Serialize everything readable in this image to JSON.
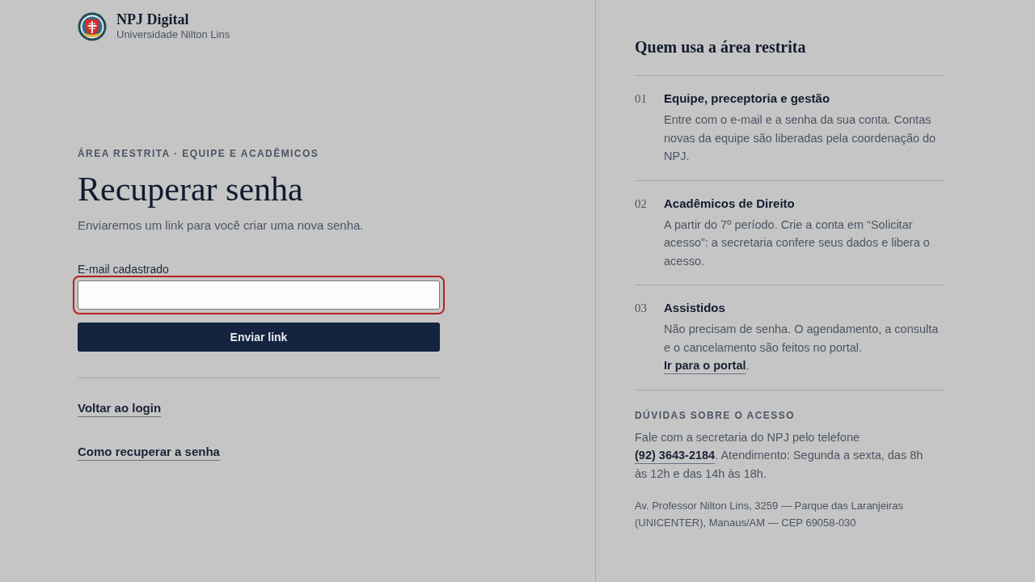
{
  "brand": {
    "name": "NPJ Digital",
    "subtitle": "Universidade Nilton Lins"
  },
  "form": {
    "eyebrow": "ÁREA RESTRITA · EQUIPE E ACADÊMICOS",
    "title": "Recuperar senha",
    "subtitle": "Enviaremos um link para você criar uma nova senha.",
    "email_field": {
      "label": "E-mail cadastrado",
      "focused": true
    },
    "submit_button": "Enviar link",
    "links": [
      "Voltar ao login",
      "Como recuperar a senha"
    ]
  },
  "info_panel": {
    "title": "Quem usa a área restrita",
    "items": [
      {
        "number": "01",
        "title": "Equipe, preceptoria e gestão",
        "description": "Entre com o e-mail e a senha da sua conta. Contas novas da equipe são liberadas pela coordenação do NPJ."
      },
      {
        "number": "02",
        "title": "Acadêmicos de Direito",
        "description": "A partir do 7º período. Crie a conta em “Solicitar acesso”: a secretaria confere seus dados e libera o acesso."
      },
      {
        "number": "03",
        "title": "Assistidos",
        "description": "Não precisam de senha. O agendamento, a consulta e o cancelamento são feitos no portal.",
        "link": "Ir para o portal",
        "description_end": "."
      }
    ],
    "contact": {
      "heading": "DÚVIDAS SOBRE O ACESSO",
      "text_before": "Fale com a secretaria do NPJ pelo telefone",
      "phone": "(92) 3643-2184",
      "text_after": ". Atendimento: Segunda a sexta, das 8h às 12h e das 14h às 18h.",
      "address": "Av. Professor Nilton Lins, 3259 — Parque das Laranjeiras (UNICENTER), Manaus/AM — CEP 69058-030"
    }
  }
}
